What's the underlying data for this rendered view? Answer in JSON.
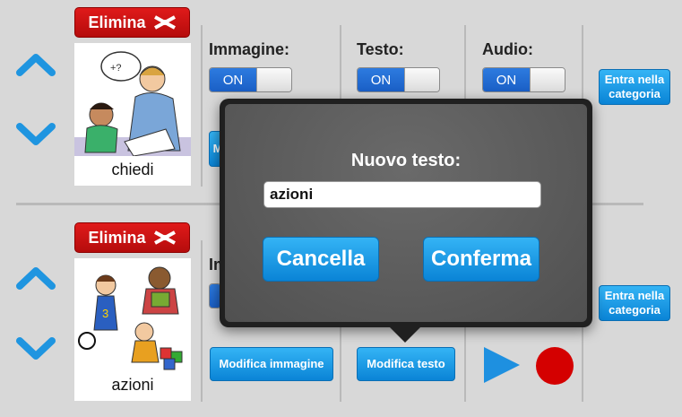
{
  "rows": [
    {
      "delete_label": "Elimina",
      "caption": "chiedi",
      "category_button": "Entra nella categoria",
      "image_button_partial": "M"
    },
    {
      "delete_label": "Elimina",
      "caption": "azioni",
      "category_button": "Entra nella categoria",
      "image_label_partial": "Im",
      "edit_image_button": "Modifica immagine",
      "edit_text_button": "Modifica testo"
    }
  ],
  "columns": {
    "image_label": "Immagine:",
    "text_label": "Testo:",
    "audio_label": "Audio:"
  },
  "toggles": {
    "image": "ON",
    "text": "ON",
    "audio": "ON"
  },
  "dialog": {
    "title": "Nuovo testo:",
    "input_value": "azioni",
    "cancel_button": "Cancella",
    "confirm_button": "Conferma"
  },
  "colors": {
    "accent_blue": "#1a8fe0",
    "delete_red": "#d01010",
    "record_red": "#d40000"
  }
}
